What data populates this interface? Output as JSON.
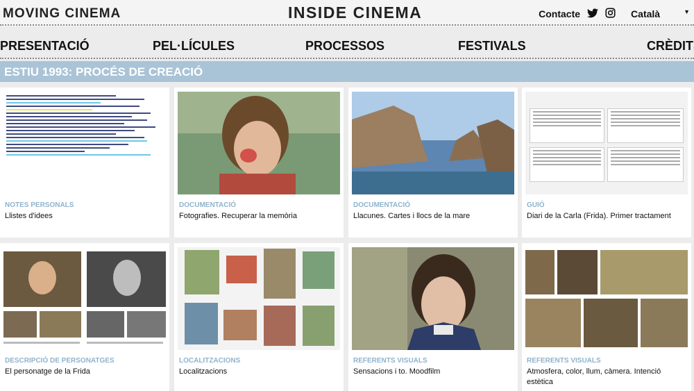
{
  "header": {
    "brand_left": "MOVING CINEMA",
    "brand_center": "INSIDE CINEMA",
    "contact_label": "Contacte",
    "language_label": "Català"
  },
  "nav": {
    "items": [
      "PRESENTACIÓ",
      "PEL·LÍCULES",
      "PROCESSOS",
      "FESTIVALS",
      "CRÈDITS"
    ]
  },
  "section": {
    "title": "ESTIU 1993: PROCÉS DE CREACIÓ"
  },
  "cards": [
    {
      "category": "NOTES PERSONALS",
      "title": "Llistes d'idees"
    },
    {
      "category": "DOCUMENTACIÓ",
      "title": "Fotografies. Recuperar la memòria"
    },
    {
      "category": "DOCUMENTACIÓ",
      "title": "Llacunes. Cartes i llocs de la mare"
    },
    {
      "category": "GUIÓ",
      "title": "Diari de la Carla (Frida). Primer tractament"
    },
    {
      "category": "DESCRIPCIÓ DE PERSONATGES",
      "title": "El personatge de la Frida"
    },
    {
      "category": "LOCALITZACIONS",
      "title": "Localitzacions"
    },
    {
      "category": "REFERENTS VISUALS",
      "title": "Sensacions i to. Moodfilm"
    },
    {
      "category": "REFERENTS VISUALS",
      "title": "Atmosfera, color, llum, càmera. Intenció estètica"
    }
  ],
  "colors": {
    "section_bar": "#a9c3d7",
    "category_text": "#8fb3cc",
    "page_bg": "#ececec"
  },
  "icons": [
    "twitter-icon",
    "instagram-icon",
    "chevron-down-icon"
  ]
}
